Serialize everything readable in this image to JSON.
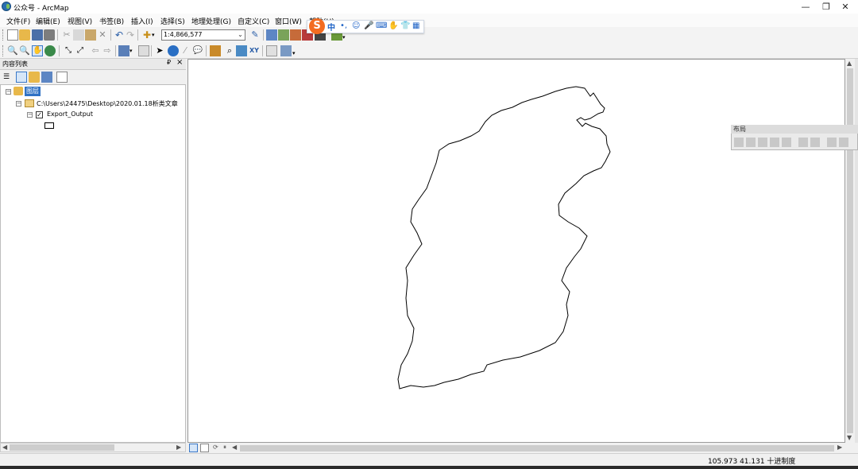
{
  "window": {
    "title": "公众号 - ArcMap"
  },
  "menus": [
    {
      "label": "文件(F)"
    },
    {
      "label": "编辑(E)"
    },
    {
      "label": "视图(V)"
    },
    {
      "label": "书签(B)"
    },
    {
      "label": "插入(I)"
    },
    {
      "label": "选择(S)"
    },
    {
      "label": "地理处理(G)"
    },
    {
      "label": "自定义(C)"
    },
    {
      "label": "窗口(W)"
    },
    {
      "label": "帮助(H)"
    }
  ],
  "toolbar": {
    "scale_value": "1:4,866,577"
  },
  "ime": {
    "logo": "S",
    "mode": "中"
  },
  "toc": {
    "title": "内容列表",
    "pin": "₽",
    "close": "×",
    "root_label": "图层",
    "folder_path": "C:\\Users\\24475\\Desktop\\2020.01.18析类文章",
    "layer_name": "Export_Output",
    "layer_checked": true
  },
  "layout_toolbar": {
    "title": "布局"
  },
  "status": {
    "coordinates": "105.973  41.131 十进制度"
  },
  "colors": {
    "selection": "#3072c4",
    "map_background": "#ffffff",
    "outline": "#000000"
  }
}
